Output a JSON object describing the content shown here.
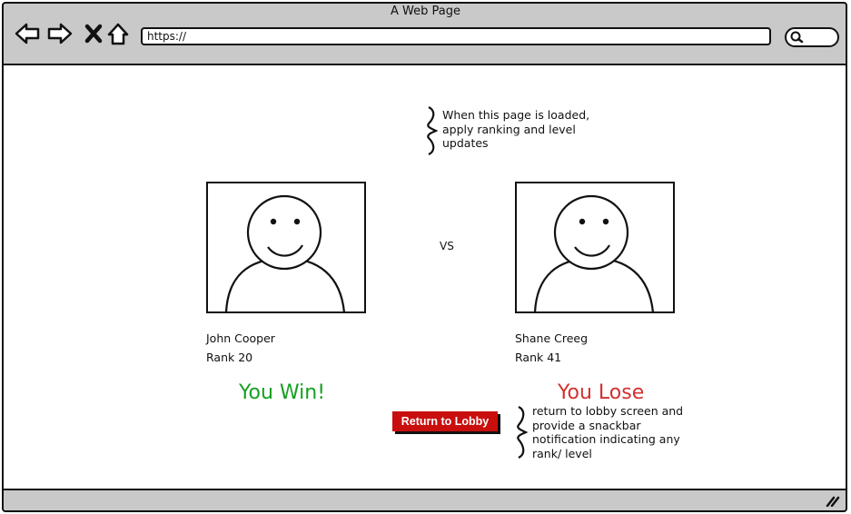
{
  "window": {
    "title": "A Web Page"
  },
  "toolbar": {
    "url": "https://"
  },
  "annotations": {
    "top_note": [
      "When this page is loaded,",
      "apply ranking and level",
      "updates"
    ],
    "bottom_note": [
      "return to lobby screen and",
      "provide a snackbar",
      "notification indicating any",
      "rank/ level"
    ]
  },
  "players": {
    "left": {
      "name": "John Cooper",
      "rank": "Rank 20",
      "result": "You Win!"
    },
    "right": {
      "name": "Shane Creeg",
      "rank": "Rank 41",
      "result": "You Lose"
    }
  },
  "versus": "VS",
  "actions": {
    "return_label": "Return to Lobby"
  },
  "colors": {
    "win": "#14a020",
    "lose": "#d33030",
    "button": "#c90e0e",
    "chrome": "#c9c9c9"
  }
}
